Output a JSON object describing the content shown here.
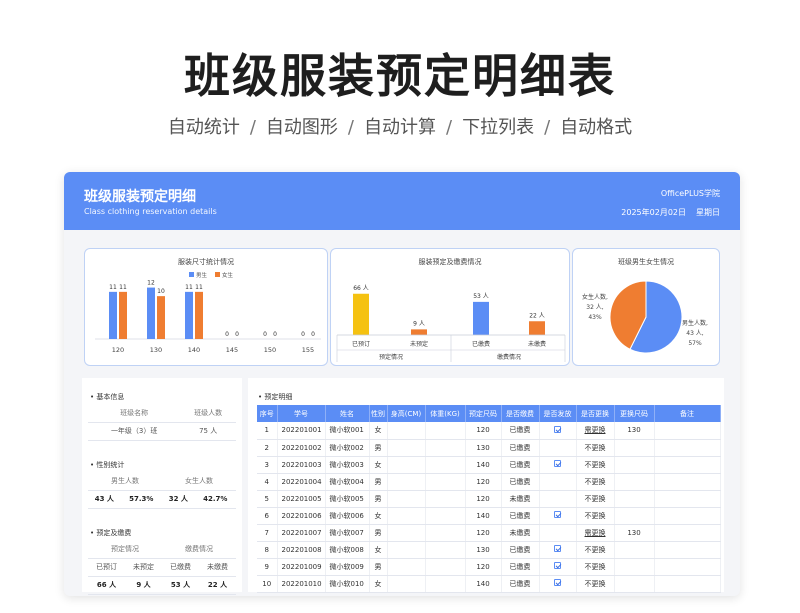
{
  "header": {
    "big_title": "班级服装预定明细表",
    "features": [
      "自动统计",
      "自动图形",
      "自动计算",
      "下拉列表",
      "自动格式"
    ]
  },
  "card": {
    "title": "班级服装预定明细",
    "subtitle": "Class clothing reservation details",
    "org": "OfficePLUS学院",
    "date": "2025年02月02日",
    "weekday": "星期日"
  },
  "colors": {
    "primary": "#5b8df5",
    "male": "#5b8df5",
    "female": "#ef7d31",
    "yellow": "#f5c211",
    "red": "#e53935"
  },
  "chart_data": [
    {
      "type": "bar",
      "title": "服装尺寸统计情况",
      "categories": [
        "120",
        "130",
        "140",
        "145",
        "150",
        "155"
      ],
      "series": [
        {
          "name": "男生",
          "values": [
            11,
            12,
            11,
            0,
            0,
            0
          ]
        },
        {
          "name": "女生",
          "values": [
            11,
            10,
            11,
            0,
            0,
            0
          ]
        }
      ],
      "legend": "top",
      "ylim": [
        0,
        14
      ]
    },
    {
      "type": "bar",
      "title": "服装预定及缴费情况",
      "categories": [
        "已预订",
        "未预定",
        "已缴费",
        "未缴费"
      ],
      "values": [
        66,
        9,
        53,
        22
      ],
      "value_labels": [
        "66 人",
        "9 人",
        "53 人",
        "22 人"
      ],
      "groups": [
        "预定情况",
        "缴费情况"
      ],
      "ylim": [
        0,
        80
      ]
    },
    {
      "type": "pie",
      "title": "班级男生女生情况",
      "slices": [
        {
          "name": "男生人数",
          "value": 43,
          "count_label": "43 人",
          "pct": "57%"
        },
        {
          "name": "女生人数",
          "value": 32,
          "count_label": "32 人",
          "pct": "43%"
        }
      ]
    }
  ],
  "info": {
    "basic": {
      "title": "基本信息",
      "headers": [
        "班级名称",
        "班级人数"
      ],
      "values": [
        "一年级（3）班",
        "75 人"
      ]
    },
    "gender": {
      "title": "性别统计",
      "headers": [
        "男生人数",
        "女生人数"
      ],
      "values": [
        "43 人",
        "57.3%",
        "32 人",
        "42.7%"
      ]
    },
    "booking": {
      "title": "预定及缴费",
      "headers": [
        "预定情况",
        "缴费情况"
      ],
      "sub_headers": [
        "已预订",
        "未预定",
        "已缴费",
        "未缴费"
      ],
      "values": [
        "66 人",
        "9 人",
        "53 人",
        "22 人"
      ]
    }
  },
  "detail": {
    "title": "预定明细",
    "columns": [
      "序号",
      "学号",
      "姓名",
      "性别",
      "身高(CM)",
      "体重(KG)",
      "预定尺码",
      "是否缴费",
      "是否发放",
      "是否更换",
      "更换尺码",
      "备注"
    ],
    "rows": [
      [
        "1",
        "202201001",
        "微小软001",
        "女",
        "",
        "",
        "120",
        "已缴费",
        "✓",
        "需更换",
        "130",
        ""
      ],
      [
        "2",
        "202201002",
        "微小软002",
        "男",
        "",
        "",
        "130",
        "已缴费",
        "",
        "不更换",
        "",
        ""
      ],
      [
        "3",
        "202201003",
        "微小软003",
        "女",
        "",
        "",
        "140",
        "已缴费",
        "✓",
        "不更换",
        "",
        ""
      ],
      [
        "4",
        "202201004",
        "微小软004",
        "男",
        "",
        "",
        "120",
        "已缴费",
        "",
        "不更换",
        "",
        ""
      ],
      [
        "5",
        "202201005",
        "微小软005",
        "男",
        "",
        "",
        "120",
        "未缴费",
        "",
        "不更换",
        "",
        ""
      ],
      [
        "6",
        "202201006",
        "微小软006",
        "女",
        "",
        "",
        "140",
        "已缴费",
        "✓",
        "不更换",
        "",
        ""
      ],
      [
        "7",
        "202201007",
        "微小软007",
        "男",
        "",
        "",
        "120",
        "未缴费",
        "",
        "需更换",
        "130",
        ""
      ],
      [
        "8",
        "202201008",
        "微小软008",
        "女",
        "",
        "",
        "130",
        "已缴费",
        "✓",
        "不更换",
        "",
        ""
      ],
      [
        "9",
        "202201009",
        "微小软009",
        "男",
        "",
        "",
        "120",
        "已缴费",
        "✓",
        "不更换",
        "",
        ""
      ],
      [
        "10",
        "202201010",
        "微小软010",
        "女",
        "",
        "",
        "140",
        "已缴费",
        "✓",
        "不更换",
        "",
        ""
      ]
    ]
  }
}
